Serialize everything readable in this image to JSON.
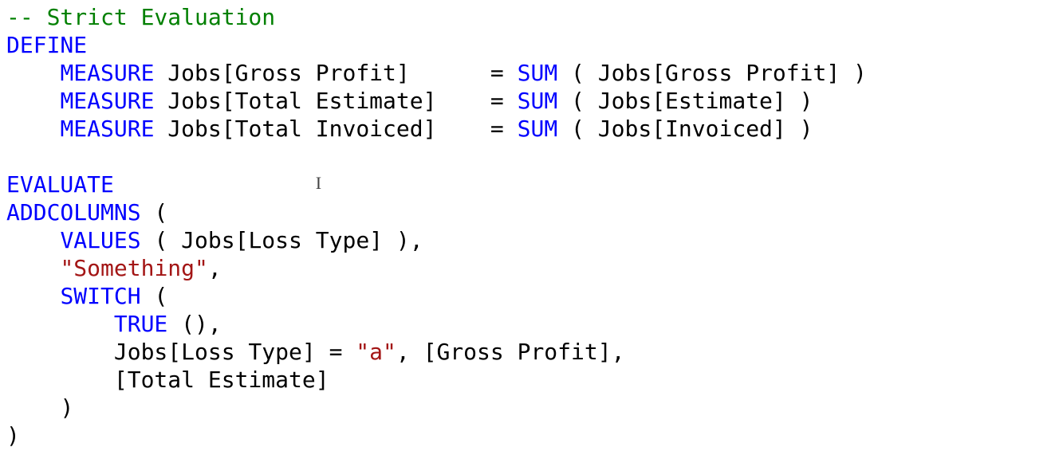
{
  "code": {
    "comment": "-- Strict Evaluation",
    "define": "DEFINE",
    "measure_kw": "MEASURE",
    "m1_name": " Jobs[Gross Profit]      ",
    "m2_name": " Jobs[Total Estimate]    ",
    "m3_name": " Jobs[Total Invoiced]    ",
    "eq": "= ",
    "sum": "SUM",
    "m1_arg": " ( Jobs[Gross Profit] )",
    "m2_arg": " ( Jobs[Estimate] )",
    "m3_arg": " ( Jobs[Invoiced] )",
    "evaluate": "EVALUATE",
    "addcolumns": "ADDCOLUMNS",
    "addcol_open": " (",
    "values": "VALUES",
    "values_arg": " ( Jobs[Loss Type] ),",
    "str_something": "\"Something\"",
    "comma": ",",
    "switch": "SWITCH",
    "switch_open": " (",
    "true": "TRUE",
    "true_tail": " (),",
    "case_left": "Jobs[Loss Type] = ",
    "str_a": "\"a\"",
    "case_right": ", [Gross Profit],",
    "else_branch": "[Total Estimate]",
    "close_inner": ")",
    "close_outer": ")",
    "indent1": "    ",
    "indent2": "        "
  }
}
